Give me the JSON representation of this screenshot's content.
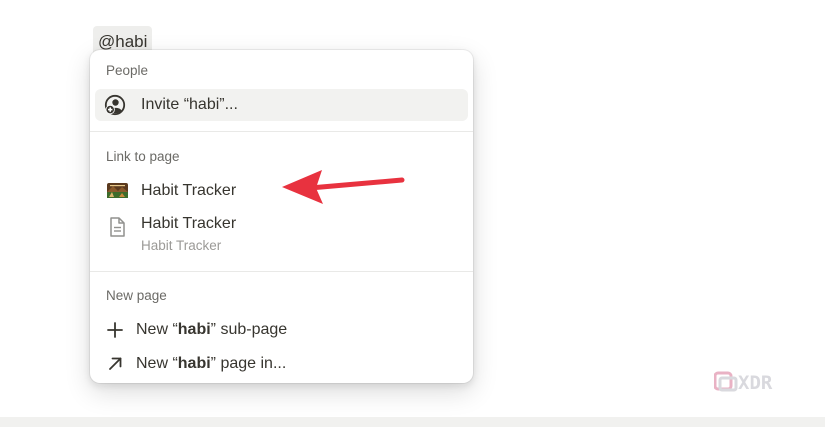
{
  "editor": {
    "mention_text": "@habi"
  },
  "menu": {
    "people": {
      "heading": "People",
      "invite_label": "Invite “habi”..."
    },
    "link_to_page": {
      "heading": "Link to page",
      "items": [
        {
          "title": "Habit Tracker",
          "icon": "habit-tracker-cover-icon"
        },
        {
          "title": "Habit Tracker",
          "subtitle": "Habit Tracker",
          "icon": "document-icon"
        }
      ]
    },
    "new_page": {
      "heading": "New page",
      "subpage": {
        "prefix": "New “",
        "query": "habi",
        "suffix": "” sub-page",
        "icon": "plus-icon"
      },
      "page_in": {
        "prefix": "New “",
        "query": "habi",
        "suffix": "” page in...",
        "icon": "arrow-up-right-icon"
      }
    }
  },
  "annotation": {
    "arrow_color": "#e8323f"
  },
  "watermark": {
    "text": "XDR"
  }
}
